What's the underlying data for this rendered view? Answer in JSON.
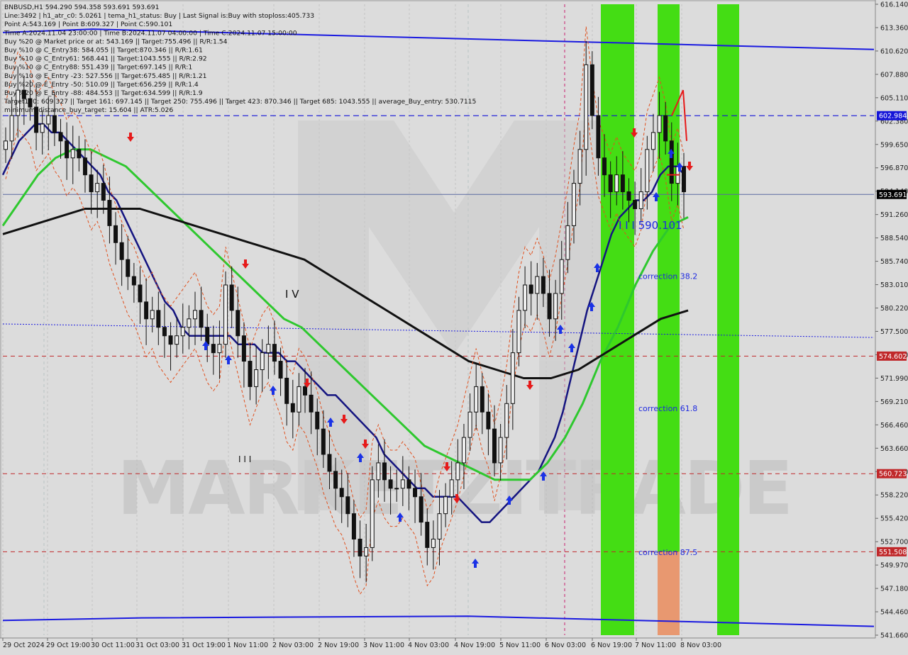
{
  "header": {
    "lines": [
      "BNBUSD,H1  594.290 594.358 593.691 593.691",
      "Line:3492 | h1_atr_c0: 5.0261 | tema_h1_status: Buy | Last Signal is:Buy with stoploss:405.733",
      "Point A:543.169 | Point B:609.327 | Point C:590.101",
      "Time A:2024.11.04 23:00:00 | Time B:2024.11.07 04:00:00 | Time C:2024.11.07 15:00:00",
      "Buy %20 @ Market price or at: 543.169 || Target:755.496 || R/R:1.54",
      "Buy %10 @ C_Entry38: 584.055 || Target:870.346 || R/R:1.61",
      "Buy %10 @ C_Entry61: 568.441 || Target:1043.555 || R/R:2.92",
      "Buy %10 @ C_Entry88: 551.439 || Target:697.145 || R/R:1",
      "Buy %10 @ E_Entry -23: 527.556 || Target:675.485 || R/R:1.21",
      "Buy %20 @ E_Entry -50: 510.09 || Target:656.259 || R/R:1.4",
      "Buy %20 @ E_Entry -88: 484.553 || Target:634.599 || R/R:1.9",
      "Target100: 609.327 || Target 161: 697.145 || Target 250: 755.496 || Target 423: 870.346 || Target 685: 1043.555 || average_Buy_entry: 530.7115",
      "minimum_distance_buy_target: 15.604 || ATR:5.026"
    ]
  },
  "chart_data": {
    "type": "candlestick",
    "symbol": "BNBUSD",
    "timeframe": "H1",
    "ohlc_last": {
      "open": 594.29,
      "high": 594.358,
      "low": 593.691,
      "close": 593.691
    },
    "ylim": [
      541.66,
      616.14
    ],
    "x_tick_labels": [
      "29 Oct 2024",
      "29 Oct 19:00",
      "30 Oct 11:00",
      "31 Oct 03:00",
      "31 Oct 19:00",
      "1 Nov 11:00",
      "2 Nov 03:00",
      "2 Nov 19:00",
      "3 Nov 11:00",
      "4 Nov 03:00",
      "4 Nov 19:00",
      "5 Nov 11:00",
      "6 Nov 03:00",
      "6 Nov 19:00",
      "7 Nov 11:00",
      "8 Nov 03:00"
    ],
    "y_tick_labels": [
      "616.140",
      "613.360",
      "610.620",
      "607.880",
      "605.110",
      "602.380",
      "599.650",
      "596.870",
      "594.140",
      "591.260",
      "588.540",
      "585.740",
      "583.010",
      "580.220",
      "577.500",
      "574.770",
      "571.990",
      "569.210",
      "566.460",
      "563.660",
      "560.950",
      "558.220",
      "555.420",
      "552.700",
      "549.970",
      "547.180",
      "544.460",
      "541.660"
    ],
    "price_tags": [
      {
        "label": "602.984",
        "value": 602.984,
        "color": "#1414d8"
      },
      {
        "label": "593.691",
        "value": 593.691,
        "color": "#000000"
      },
      {
        "label": "574.602",
        "value": 574.602,
        "color": "#c0282a"
      },
      {
        "label": "560.723",
        "value": 560.723,
        "color": "#c0282a"
      },
      {
        "label": "551.508",
        "value": 551.508,
        "color": "#c0282a"
      }
    ],
    "annotations": [
      {
        "text": "correction 38.2",
        "value": 584.055
      },
      {
        "text": "correction 61.8",
        "value": 568.441
      },
      {
        "text": "correction 87.5",
        "value": 551.439
      },
      {
        "text": "I I I 590.101",
        "value": 590.101
      },
      {
        "text": "I V",
        "value": 583.0
      },
      {
        "text": "I I I",
        "value": 563.0
      }
    ],
    "watermark": "MARKETZITRADE",
    "series": [
      {
        "name": "close_approx",
        "values": [
          600,
          603,
          606,
          605,
          604,
          601,
          602,
          603,
          601,
          600,
          598,
          599,
          598,
          596,
          594,
          595,
          593,
          590,
          588,
          586,
          584,
          583,
          581,
          579,
          580,
          578,
          577,
          576,
          577,
          578,
          579,
          580,
          578,
          576,
          575,
          576,
          583,
          580,
          577,
          574,
          571,
          573,
          575,
          576,
          574,
          572,
          569,
          568,
          571,
          570,
          568,
          566,
          563,
          561,
          559,
          558,
          556,
          553,
          551,
          552,
          560,
          562,
          560,
          559,
          559,
          560,
          559,
          558,
          555,
          552,
          553,
          556,
          558,
          560,
          562,
          565,
          568,
          571,
          568,
          566,
          562,
          565,
          569,
          575,
          580,
          583,
          582,
          584,
          582,
          579,
          582,
          586,
          590,
          595,
          599,
          609,
          603,
          598,
          596,
          594,
          596,
          594,
          593,
          592,
          594,
          599,
          601,
          603,
          600,
          595,
          597,
          594
        ]
      },
      {
        "name": "ma_navy_approx",
        "values": [
          596,
          598,
          600,
          601,
          602,
          602,
          601,
          601,
          600,
          599,
          598,
          597,
          596,
          594,
          593,
          591,
          589,
          587,
          585,
          583,
          581,
          580,
          578,
          577,
          577,
          577,
          577,
          577,
          577,
          576,
          576,
          576,
          575,
          575,
          575,
          574,
          574,
          573,
          572,
          571,
          570,
          570,
          569,
          568,
          567,
          566,
          565,
          563,
          562,
          561,
          560,
          559,
          559,
          558,
          558,
          558,
          558,
          557,
          556,
          555,
          555,
          556,
          557,
          558,
          559,
          560,
          561,
          563,
          565,
          568,
          572,
          576,
          580,
          583,
          586,
          589,
          591,
          592,
          593,
          593,
          594,
          596,
          597,
          597,
          596
        ]
      },
      {
        "name": "ma_green_approx",
        "values": [
          590,
          593,
          596,
          598,
          599,
          599,
          598,
          597,
          595,
          593,
          591,
          589,
          587,
          585,
          583,
          581,
          579,
          578,
          576,
          574,
          572,
          570,
          568,
          566,
          564,
          563,
          562,
          561,
          560,
          560,
          560,
          562,
          565,
          569,
          574,
          578,
          583,
          587,
          590,
          591
        ]
      },
      {
        "name": "ma_black_approx",
        "values": [
          589,
          590,
          591,
          592,
          592,
          592,
          591,
          590,
          589,
          588,
          587,
          586,
          584,
          582,
          580,
          578,
          576,
          574,
          573,
          572,
          572,
          573,
          575,
          577,
          579,
          580
        ]
      }
    ]
  }
}
